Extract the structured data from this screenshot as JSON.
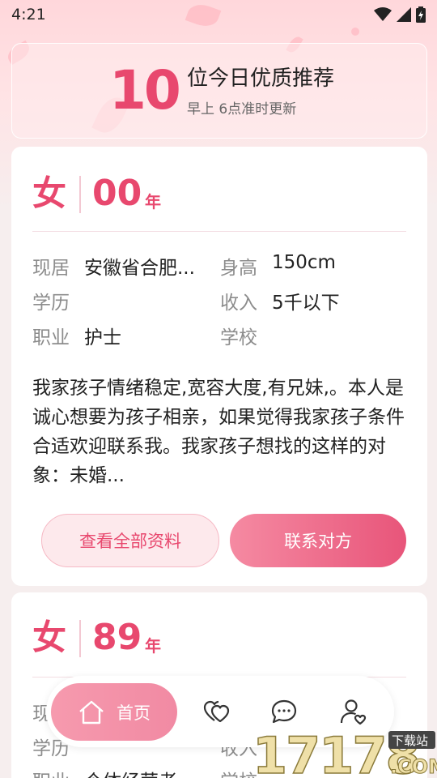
{
  "status_bar": {
    "time": "4:21"
  },
  "banner": {
    "count": "10",
    "title": "位今日优质推荐",
    "subtitle": "早上 6点准时更新"
  },
  "cards": [
    {
      "gender": "女",
      "birth_year": "00",
      "birth_unit": "年",
      "info": [
        {
          "label": "现居",
          "value": "安徽省合肥..."
        },
        {
          "label": "身高",
          "value": "150cm"
        },
        {
          "label": "学历",
          "value": ""
        },
        {
          "label": "收入",
          "value": "5千以下"
        },
        {
          "label": "职业",
          "value": "护士"
        },
        {
          "label": "学校",
          "value": ""
        }
      ],
      "bio": "我家孩子情绪稳定,宽容大度,有兄妹,。本人是诚心想要为孩子相亲，如果觉得我家孩子条件合适欢迎联系我。我家孩子想找的这样的对象：未婚...",
      "view_button": "查看全部资料",
      "contact_button": "联系对方"
    },
    {
      "gender": "女",
      "birth_year": "89",
      "birth_unit": "年",
      "info": [
        {
          "label": "现居",
          "value": ""
        },
        {
          "label": "学历",
          "value": ""
        },
        {
          "label": "收入",
          "value": ""
        },
        {
          "label": "职业",
          "value": "个体经营者"
        },
        {
          "label": "学校",
          "value": ""
        }
      ]
    }
  ],
  "bottom_nav": {
    "items": [
      {
        "label": "首页",
        "icon": "home-icon",
        "active": true
      },
      {
        "label": "",
        "icon": "hearts-icon"
      },
      {
        "label": "",
        "icon": "chat-icon"
      },
      {
        "label": "",
        "icon": "profile-icon"
      }
    ]
  },
  "watermark": {
    "text": "17178",
    "badge": "下载站",
    "domain": ".COM"
  },
  "colors": {
    "accent": "#e8486e",
    "accent_light": "#f69aae",
    "background": "#f6eeee"
  }
}
